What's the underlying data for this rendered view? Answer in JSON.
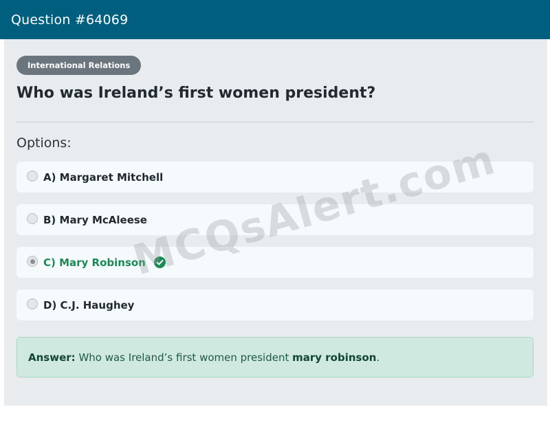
{
  "header": {
    "title": "Question #64069"
  },
  "category": "International Relations",
  "question": "Who was Ireland’s first women president?",
  "options_label": "Options:",
  "options": [
    {
      "label": "A) Margaret Mitchell",
      "selected": false,
      "correct": false
    },
    {
      "label": "B) Mary McAleese",
      "selected": false,
      "correct": false
    },
    {
      "label": "C) Mary Robinson",
      "selected": true,
      "correct": true
    },
    {
      "label": "D) C.J. Haughey",
      "selected": false,
      "correct": false
    }
  ],
  "answer": {
    "prefix": "Answer:",
    "text": "Who was Ireland’s first women president",
    "highlight": "mary robinson",
    "suffix": "."
  },
  "watermark": "MCQsAlert.com",
  "colors": {
    "header_bg": "#005f7f",
    "correct_green": "#1d8a55",
    "answer_bg": "#cfe8e0",
    "badge_bg": "#6b757d"
  }
}
